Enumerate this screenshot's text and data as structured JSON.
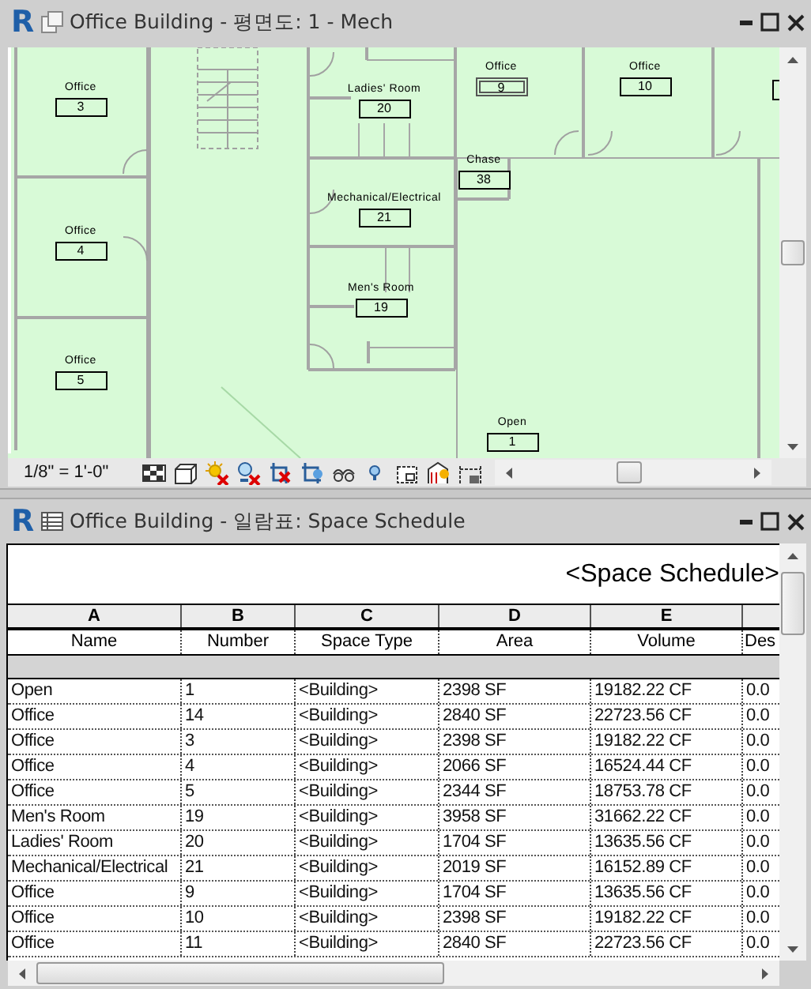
{
  "plan_window": {
    "logo": "R",
    "title": "Office Building - 평면도: 1 - Mech",
    "rooms": [
      {
        "name": "Office",
        "number": "3",
        "selected": false
      },
      {
        "name": "Office",
        "number": "4",
        "selected": false
      },
      {
        "name": "Office",
        "number": "5",
        "selected": false
      },
      {
        "name": "Ladies' Room",
        "number": "20",
        "selected": false
      },
      {
        "name": "Mechanical/Electrical",
        "number": "21",
        "selected": false
      },
      {
        "name": "Men's Room",
        "number": "19",
        "selected": false
      },
      {
        "name": "Office",
        "number": "9",
        "selected": true
      },
      {
        "name": "Office",
        "number": "10",
        "selected": false
      },
      {
        "name": "Chase",
        "number": "38",
        "selected": false
      },
      {
        "name": "Open",
        "number": "1",
        "selected": false
      }
    ],
    "view_control_bar": {
      "scale": "1/8\" = 1'-0\""
    }
  },
  "schedule_window": {
    "logo": "R",
    "title": "Office Building - 일람표: Space Schedule",
    "schedule_title": "<Space Schedule>",
    "columns": [
      {
        "letter": "A",
        "heading": "Name"
      },
      {
        "letter": "B",
        "heading": "Number"
      },
      {
        "letter": "C",
        "heading": "Space Type"
      },
      {
        "letter": "D",
        "heading": "Area"
      },
      {
        "letter": "E",
        "heading": "Volume"
      },
      {
        "heading": "Des"
      }
    ],
    "rows": [
      [
        "Open",
        "1",
        "<Building>",
        "2398 SF",
        "19182.22 CF",
        "0.0"
      ],
      [
        "Office",
        "14",
        "<Building>",
        "2840 SF",
        "22723.56 CF",
        "0.0"
      ],
      [
        "Office",
        "3",
        "<Building>",
        "2398 SF",
        "19182.22 CF",
        "0.0"
      ],
      [
        "Office",
        "4",
        "<Building>",
        "2066 SF",
        "16524.44 CF",
        "0.0"
      ],
      [
        "Office",
        "5",
        "<Building>",
        "2344 SF",
        "18753.78 CF",
        "0.0"
      ],
      [
        "Men's Room",
        "19",
        "<Building>",
        "3958 SF",
        "31662.22 CF",
        "0.0"
      ],
      [
        "Ladies' Room",
        "20",
        "<Building>",
        "1704 SF",
        "13635.56 CF",
        "0.0"
      ],
      [
        "Mechanical/Electrical",
        "21",
        "<Building>",
        "2019 SF",
        "16152.89 CF",
        "0.0"
      ],
      [
        "Office",
        "9",
        "<Building>",
        "1704 SF",
        "13635.56 CF",
        "0.0"
      ],
      [
        "Office",
        "10",
        "<Building>",
        "2398 SF",
        "19182.22 CF",
        "0.0"
      ],
      [
        "Office",
        "11",
        "<Building>",
        "2840 SF",
        "22723.56 CF",
        "0.0"
      ]
    ]
  }
}
